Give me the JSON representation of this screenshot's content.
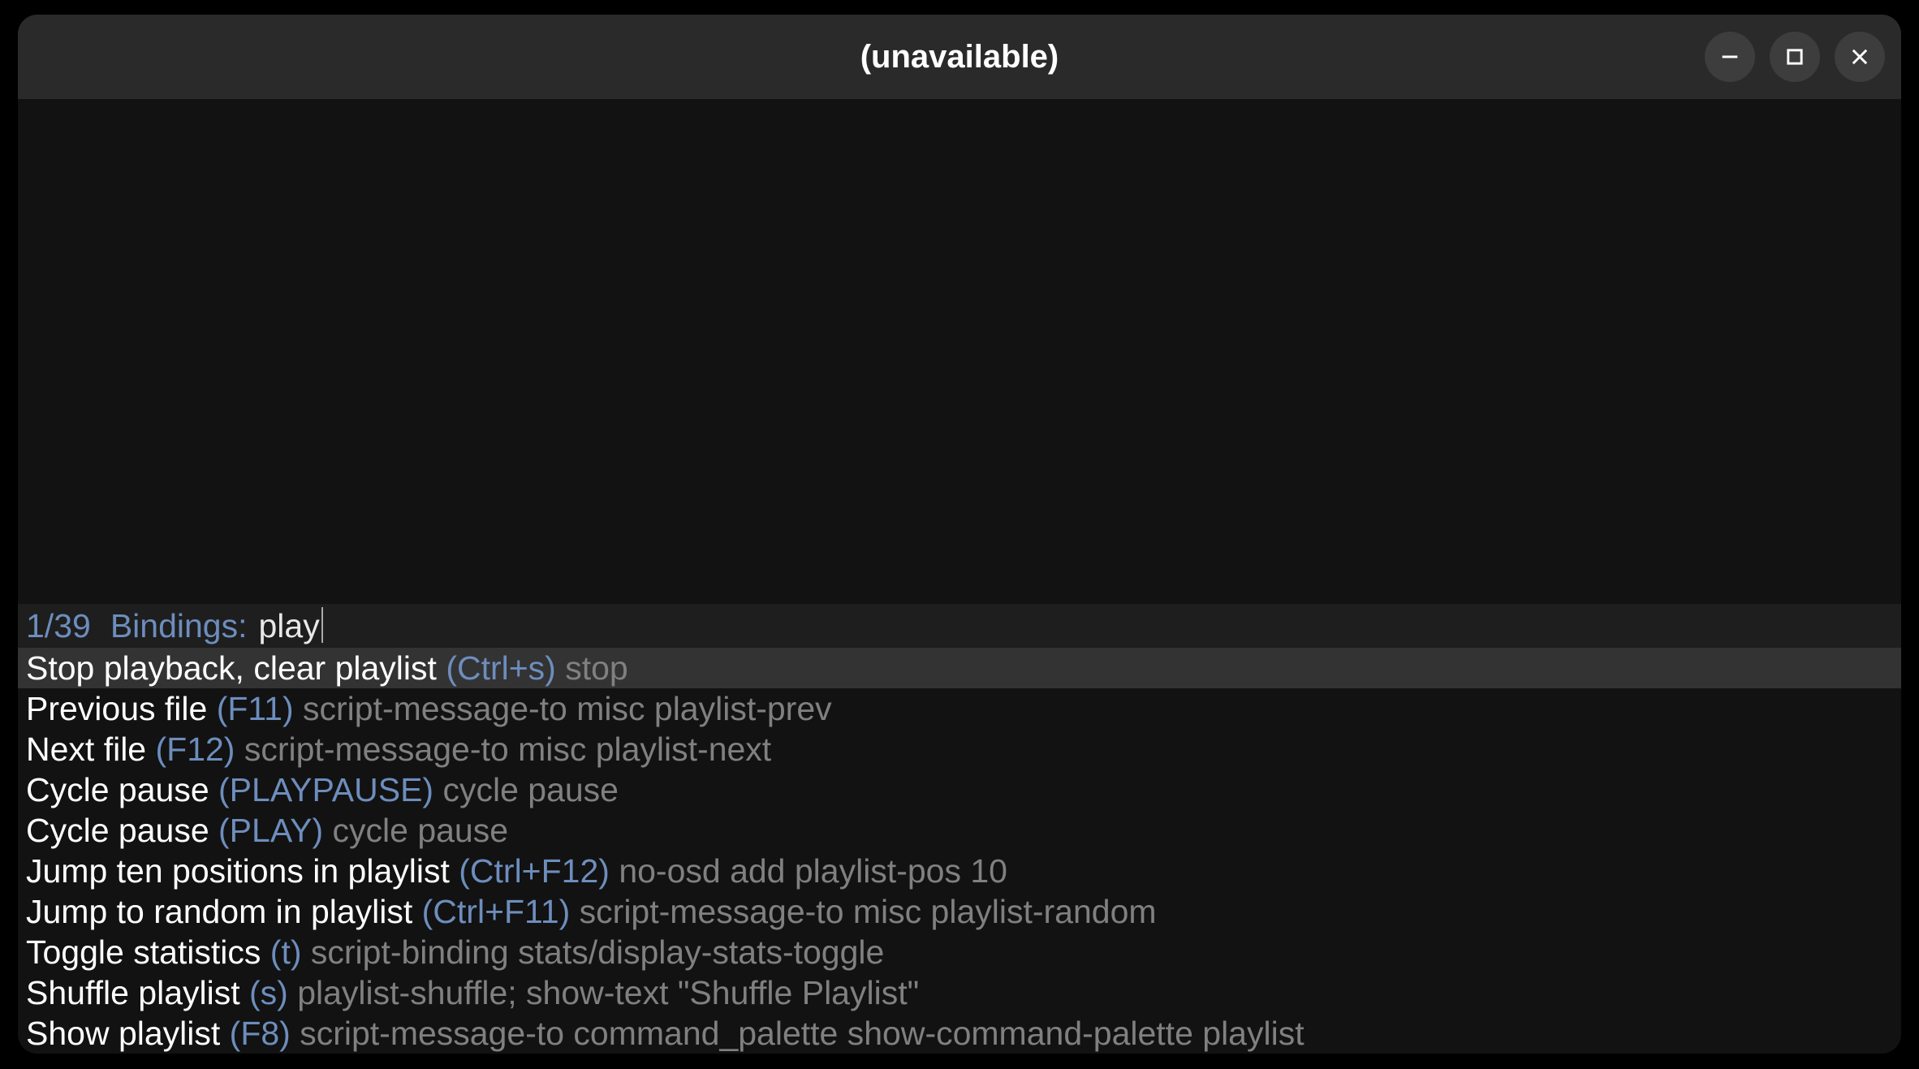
{
  "window": {
    "title": "(unavailable)"
  },
  "palette": {
    "count": "1/39",
    "label": "Bindings:",
    "query": "play"
  },
  "bindings": [
    {
      "name": "Stop playback, clear playlist",
      "key": "(Ctrl+s)",
      "cmd": "stop",
      "selected": true
    },
    {
      "name": "Previous file",
      "key": "(F11)",
      "cmd": "script-message-to misc playlist-prev",
      "selected": false
    },
    {
      "name": "Next file",
      "key": "(F12)",
      "cmd": "script-message-to misc playlist-next",
      "selected": false
    },
    {
      "name": "Cycle pause",
      "key": "(PLAYPAUSE)",
      "cmd": "cycle pause",
      "selected": false
    },
    {
      "name": "Cycle pause",
      "key": "(PLAY)",
      "cmd": "cycle pause",
      "selected": false
    },
    {
      "name": "Jump ten positions in playlist",
      "key": "(Ctrl+F12)",
      "cmd": "no-osd add playlist-pos 10",
      "selected": false
    },
    {
      "name": "Jump to random in playlist",
      "key": "(Ctrl+F11)",
      "cmd": "script-message-to misc playlist-random",
      "selected": false
    },
    {
      "name": "Toggle statistics",
      "key": "(t)",
      "cmd": "script-binding stats/display-stats-toggle",
      "selected": false
    },
    {
      "name": "Shuffle playlist",
      "key": "(s)",
      "cmd": "playlist-shuffle; show-text \"Shuffle Playlist\"",
      "selected": false
    },
    {
      "name": "Show playlist",
      "key": "(F8)",
      "cmd": "script-message-to command_palette show-command-palette playlist",
      "selected": false
    }
  ]
}
